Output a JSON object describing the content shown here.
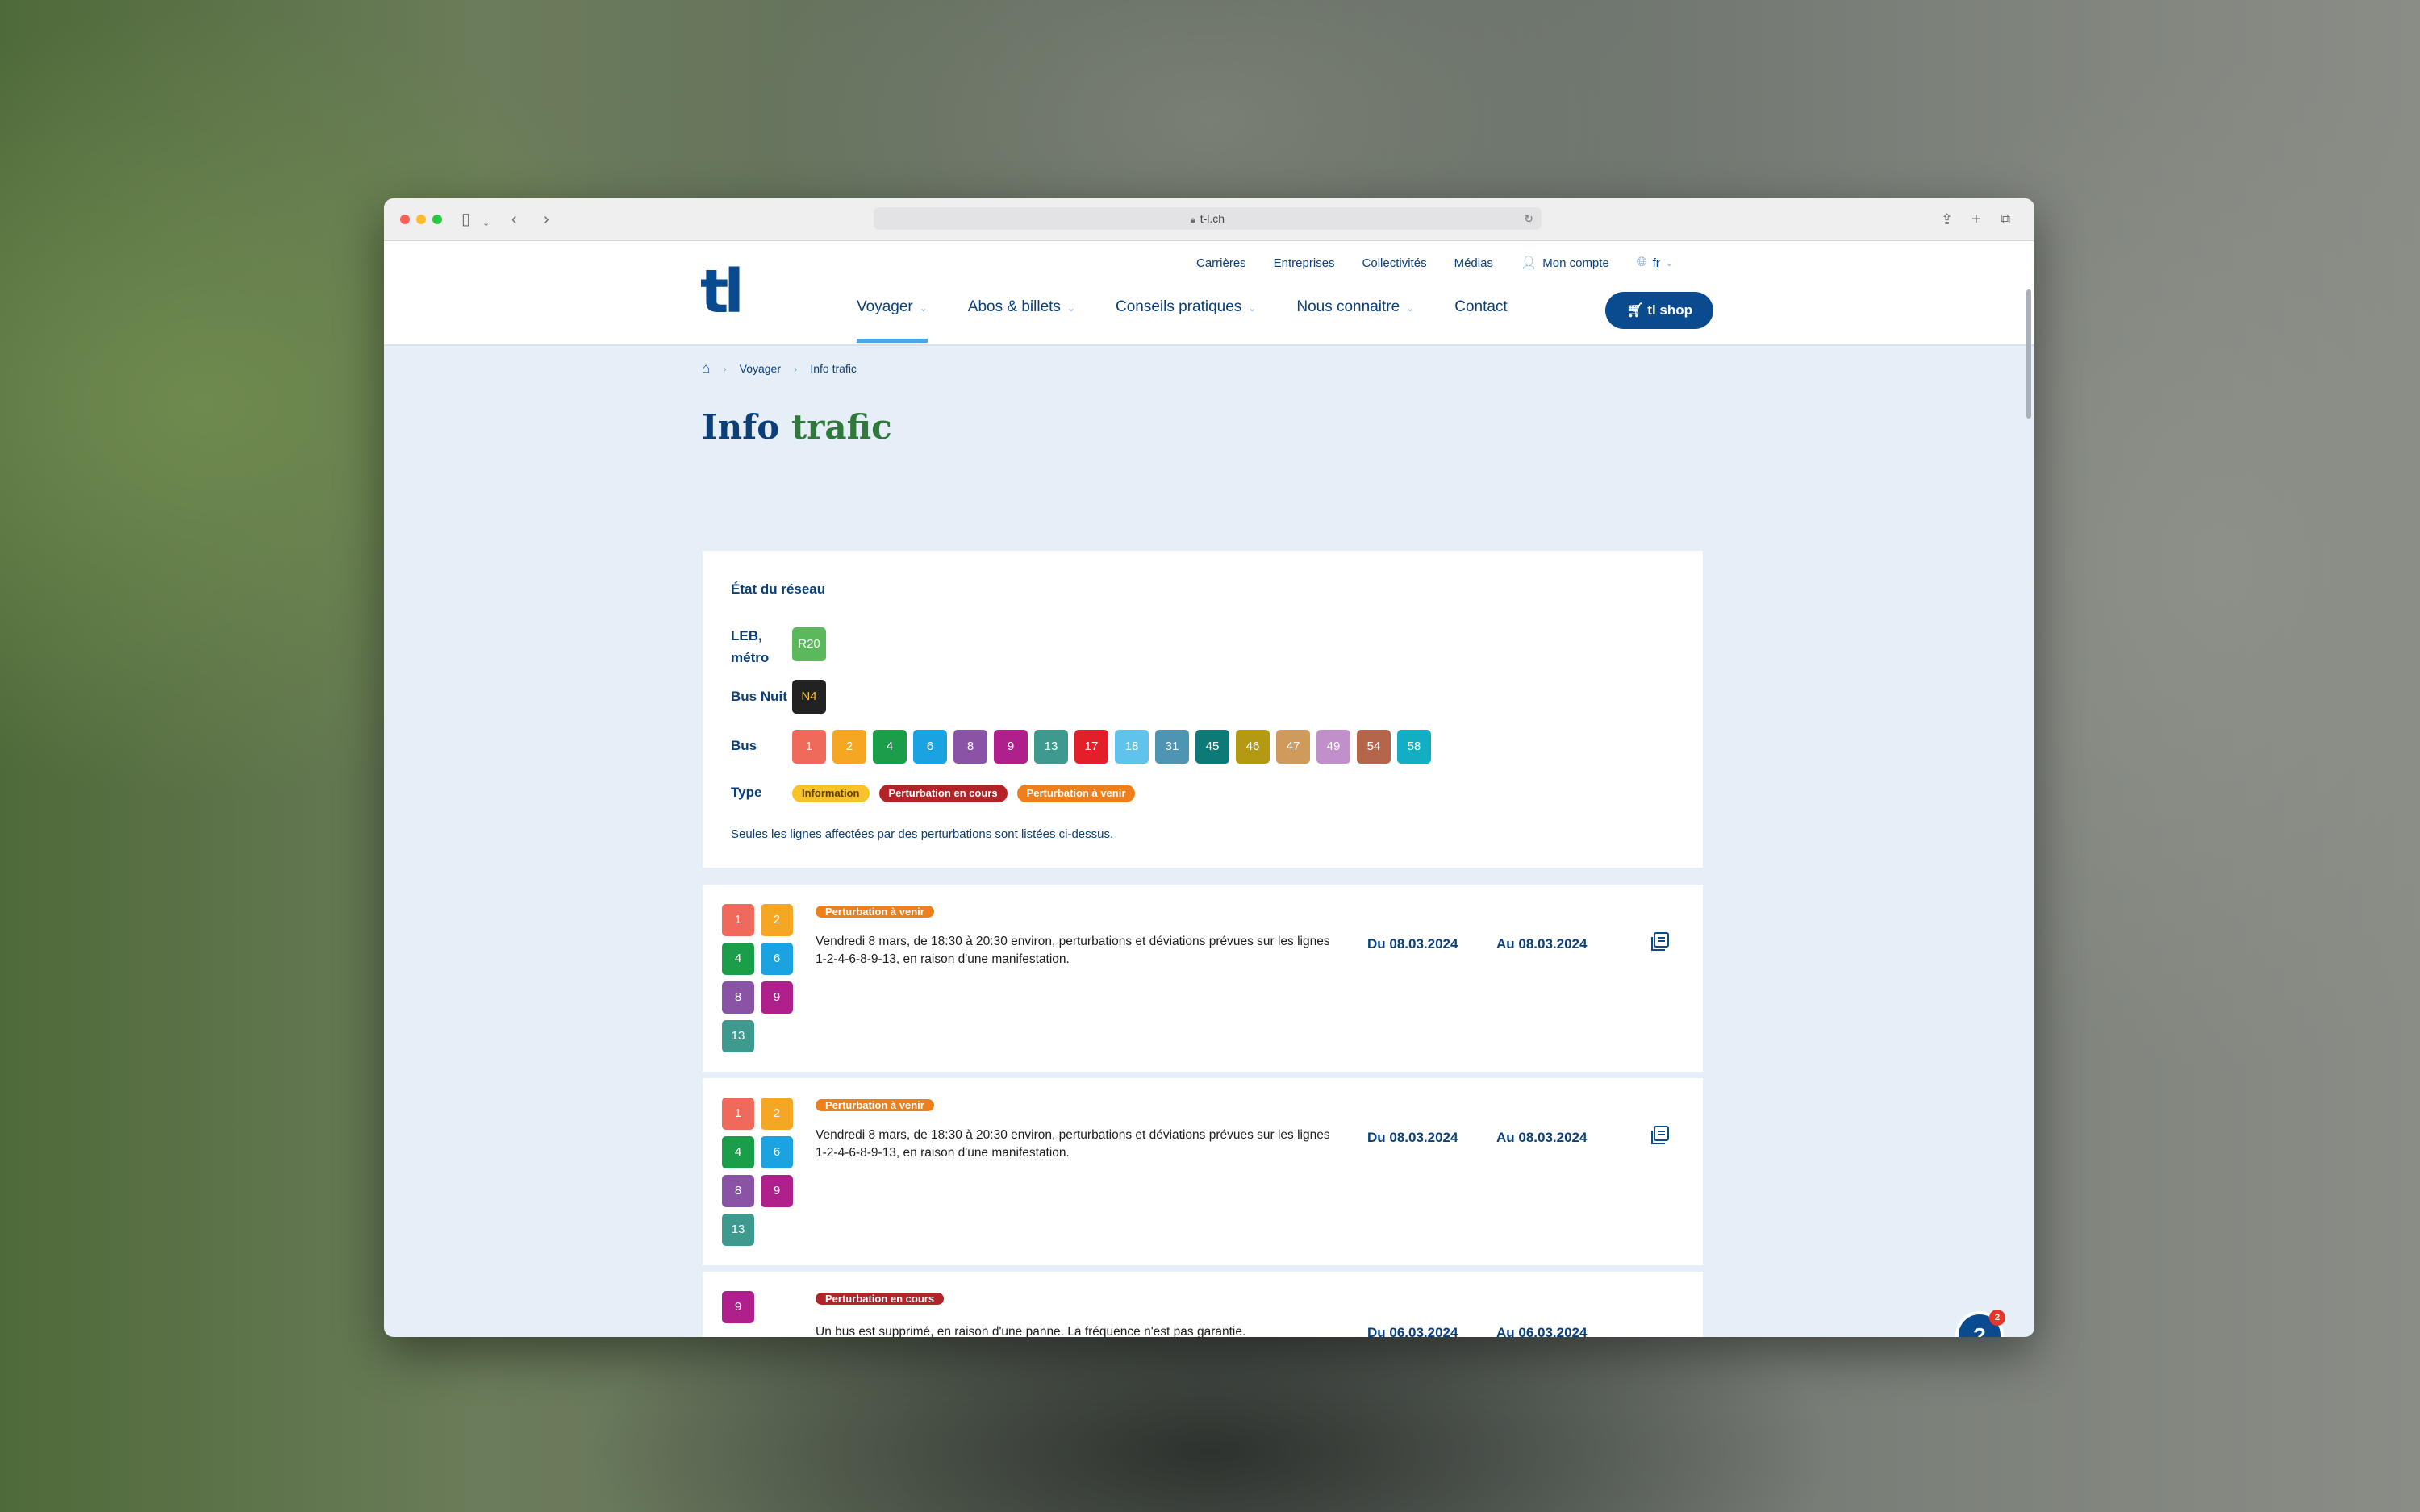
{
  "browser": {
    "url": "t-l.ch"
  },
  "header": {
    "logo": "tl",
    "top_links": [
      "Carrières",
      "Entreprises",
      "Collectivités",
      "Médias"
    ],
    "account_label": "Mon compte",
    "language": "fr",
    "nav": [
      "Voyager",
      "Abos & billets",
      "Conseils pratiques",
      "Nous connaitre",
      "Contact"
    ],
    "shop_label": "tl shop"
  },
  "breadcrumb": {
    "items": [
      "Voyager",
      "Info trafic"
    ]
  },
  "page": {
    "title_part1": "Info",
    "title_part2": "trafic"
  },
  "network": {
    "heading": "État du réseau",
    "leb_label": "LEB, métro",
    "leb_lines": [
      {
        "label": "R20",
        "color": "#5cb85c"
      }
    ],
    "night_label": "Bus Nuit",
    "night_lines": [
      {
        "label": "N4",
        "color": "#222222",
        "text_color": "#f2c12e"
      }
    ],
    "bus_label": "Bus",
    "bus_lines": [
      {
        "label": "1",
        "color": "#ef6a5a"
      },
      {
        "label": "2",
        "color": "#f5a623"
      },
      {
        "label": "4",
        "color": "#1a9e4a"
      },
      {
        "label": "6",
        "color": "#1aa3e0"
      },
      {
        "label": "8",
        "color": "#8a53a6"
      },
      {
        "label": "9",
        "color": "#b0208c"
      },
      {
        "label": "13",
        "color": "#3e9a8e"
      },
      {
        "label": "17",
        "color": "#e3202a"
      },
      {
        "label": "18",
        "color": "#5fc3ec"
      },
      {
        "label": "31",
        "color": "#4d95b3"
      },
      {
        "label": "45",
        "color": "#0e7a78"
      },
      {
        "label": "46",
        "color": "#b39a12"
      },
      {
        "label": "47",
        "color": "#cf9a5a"
      },
      {
        "label": "49",
        "color": "#c18fc9"
      },
      {
        "label": "54",
        "color": "#b5664a"
      },
      {
        "label": "58",
        "color": "#12afc4"
      }
    ],
    "type_label": "Type",
    "types": [
      "Information",
      "Perturbation en cours",
      "Perturbation à venir"
    ],
    "note": "Seules les lignes affectées par des perturbations sont listées ci-dessus."
  },
  "disruptions": [
    {
      "lines": [
        {
          "label": "1",
          "color": "#ef6a5a"
        },
        {
          "label": "2",
          "color": "#f5a623"
        },
        {
          "label": "4",
          "color": "#1a9e4a"
        },
        {
          "label": "6",
          "color": "#1aa3e0"
        },
        {
          "label": "8",
          "color": "#8a53a6"
        },
        {
          "label": "9",
          "color": "#b0208c"
        },
        {
          "label": "13",
          "color": "#3e9a8e"
        }
      ],
      "type": "Perturbation à venir",
      "text": "Vendredi 8 mars, de 18:30 à 20:30 environ, perturbations et déviations prévues sur les lignes 1-2-4-6-8-9-13, en raison d'une manifestation.",
      "from": "Du 08.03.2024",
      "to": "Au 08.03.2024"
    },
    {
      "lines": [
        {
          "label": "1",
          "color": "#ef6a5a"
        },
        {
          "label": "2",
          "color": "#f5a623"
        },
        {
          "label": "4",
          "color": "#1a9e4a"
        },
        {
          "label": "6",
          "color": "#1aa3e0"
        },
        {
          "label": "8",
          "color": "#8a53a6"
        },
        {
          "label": "9",
          "color": "#b0208c"
        },
        {
          "label": "13",
          "color": "#3e9a8e"
        }
      ],
      "type": "Perturbation à venir",
      "text": "Vendredi 8 mars, de 18:30 à 20:30 environ, perturbations et déviations prévues sur les lignes 1-2-4-6-8-9-13, en raison d'une manifestation.",
      "from": "Du 08.03.2024",
      "to": "Au 08.03.2024"
    },
    {
      "lines": [
        {
          "label": "9",
          "color": "#b0208c"
        }
      ],
      "type": "Perturbation en cours",
      "text": "Un bus est supprimé, en raison d'une panne. La fréquence n'est pas garantie.",
      "from": "Du 06.03.2024",
      "to": "Au 06.03.2024"
    }
  ],
  "help": {
    "icon": "?",
    "badge_count": "2"
  }
}
